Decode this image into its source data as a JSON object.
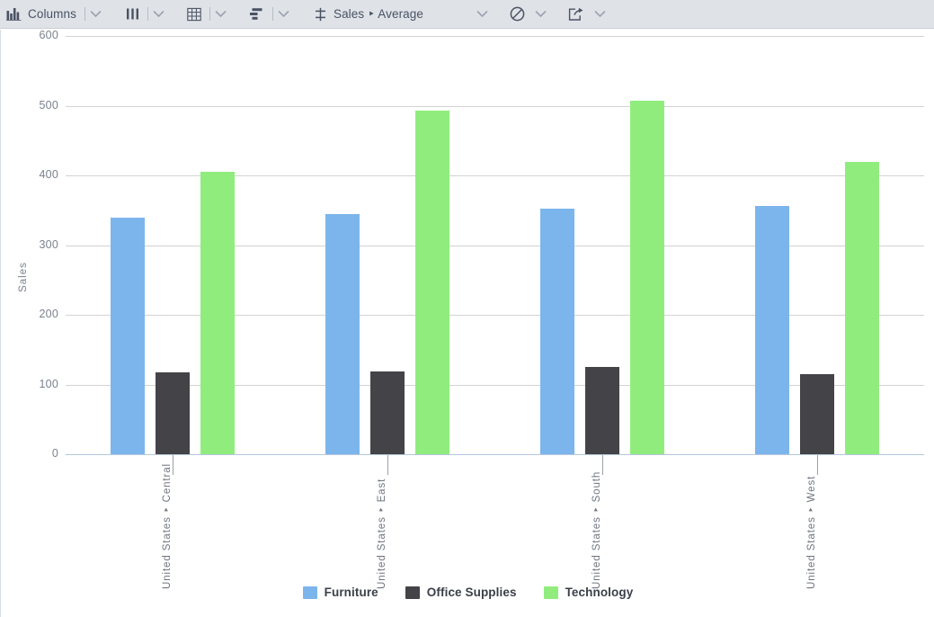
{
  "toolbar": {
    "columns_button": {
      "label": "Columns",
      "icon": "bar-chart-icon"
    },
    "columns_caret": {
      "icon": "chevron-down-icon"
    },
    "bars_button": {
      "icon": "vertical-bars-icon"
    },
    "bars_caret": {
      "icon": "chevron-down-icon"
    },
    "grid_button": {
      "icon": "table-grid-icon"
    },
    "grid_caret": {
      "icon": "chevron-down-icon"
    },
    "sort_button": {
      "icon": "sort-bars-icon"
    },
    "sort_caret": {
      "icon": "chevron-down-icon"
    },
    "measure_button": {
      "label": "Sales ‣ Average",
      "icon": "axis-split-icon"
    },
    "measure_caret": {
      "icon": "chevron-down-icon"
    },
    "block_button": {
      "icon": "no-entry-icon"
    },
    "block_caret": {
      "icon": "chevron-down-icon"
    },
    "export_button": {
      "icon": "export-share-icon"
    },
    "export_caret": {
      "icon": "chevron-down-icon"
    }
  },
  "chart_data": {
    "type": "bar",
    "title": "",
    "subtitle": "",
    "xlabel": "",
    "ylabel": "Sales",
    "ylim": [
      0,
      600
    ],
    "yticks": [
      0,
      100,
      200,
      300,
      400,
      500,
      600
    ],
    "grid": true,
    "legend_position": "bottom",
    "categories": [
      "United States ‣ Central",
      "United States ‣ East",
      "United States ‣ South",
      "United States ‣ West"
    ],
    "series": [
      {
        "name": "Furniture",
        "color": "#7CB5EC",
        "values": [
          340,
          345,
          352,
          356
        ]
      },
      {
        "name": "Office Supplies",
        "color": "#434348",
        "values": [
          117,
          119,
          125,
          115
        ]
      },
      {
        "name": "Technology",
        "color": "#90ED7D",
        "values": [
          405,
          493,
          507,
          419
        ]
      }
    ]
  }
}
